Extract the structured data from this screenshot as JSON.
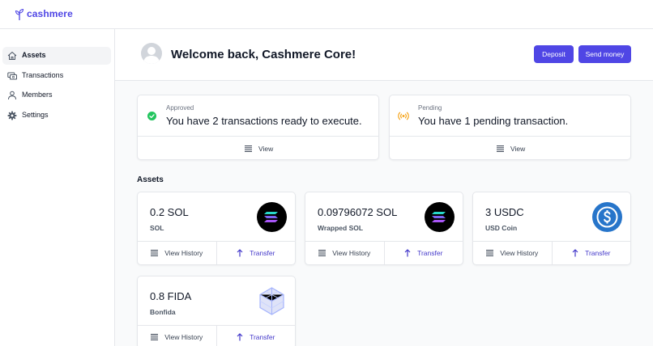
{
  "app": {
    "name": "cashmere"
  },
  "sidebar": {
    "items": [
      {
        "label": "Assets",
        "icon": "home-icon"
      },
      {
        "label": "Transactions",
        "icon": "transactions-icon"
      },
      {
        "label": "Members",
        "icon": "members-icon"
      },
      {
        "label": "Settings",
        "icon": "gear-icon"
      }
    ]
  },
  "header": {
    "welcome": "Welcome back, Cashmere Core!",
    "deposit_label": "Deposit",
    "send_label": "Send money"
  },
  "status": {
    "approved": {
      "label": "Approved",
      "text": "You have 2 transactions ready to execute.",
      "action": "View"
    },
    "pending": {
      "label": "Pending",
      "text": "You have 1 pending transaction.",
      "action": "View"
    }
  },
  "assets": {
    "title": "Assets",
    "history_label": "View History",
    "transfer_label": "Transfer",
    "items": [
      {
        "amount": "0.2 SOL",
        "name": "SOL",
        "logo": "solana-logo"
      },
      {
        "amount": "0.09796072 SOL",
        "name": "Wrapped SOL",
        "logo": "solana-logo"
      },
      {
        "amount": "3 USDC",
        "name": "USD Coin",
        "logo": "usdc-logo"
      },
      {
        "amount": "0.8 FIDA",
        "name": "Bonfida",
        "logo": "bonfida-logo"
      }
    ]
  },
  "colors": {
    "accent": "#4f46e5",
    "approved": "#22c55e",
    "pending": "#f59e0b",
    "usdc": "#2775ca"
  }
}
